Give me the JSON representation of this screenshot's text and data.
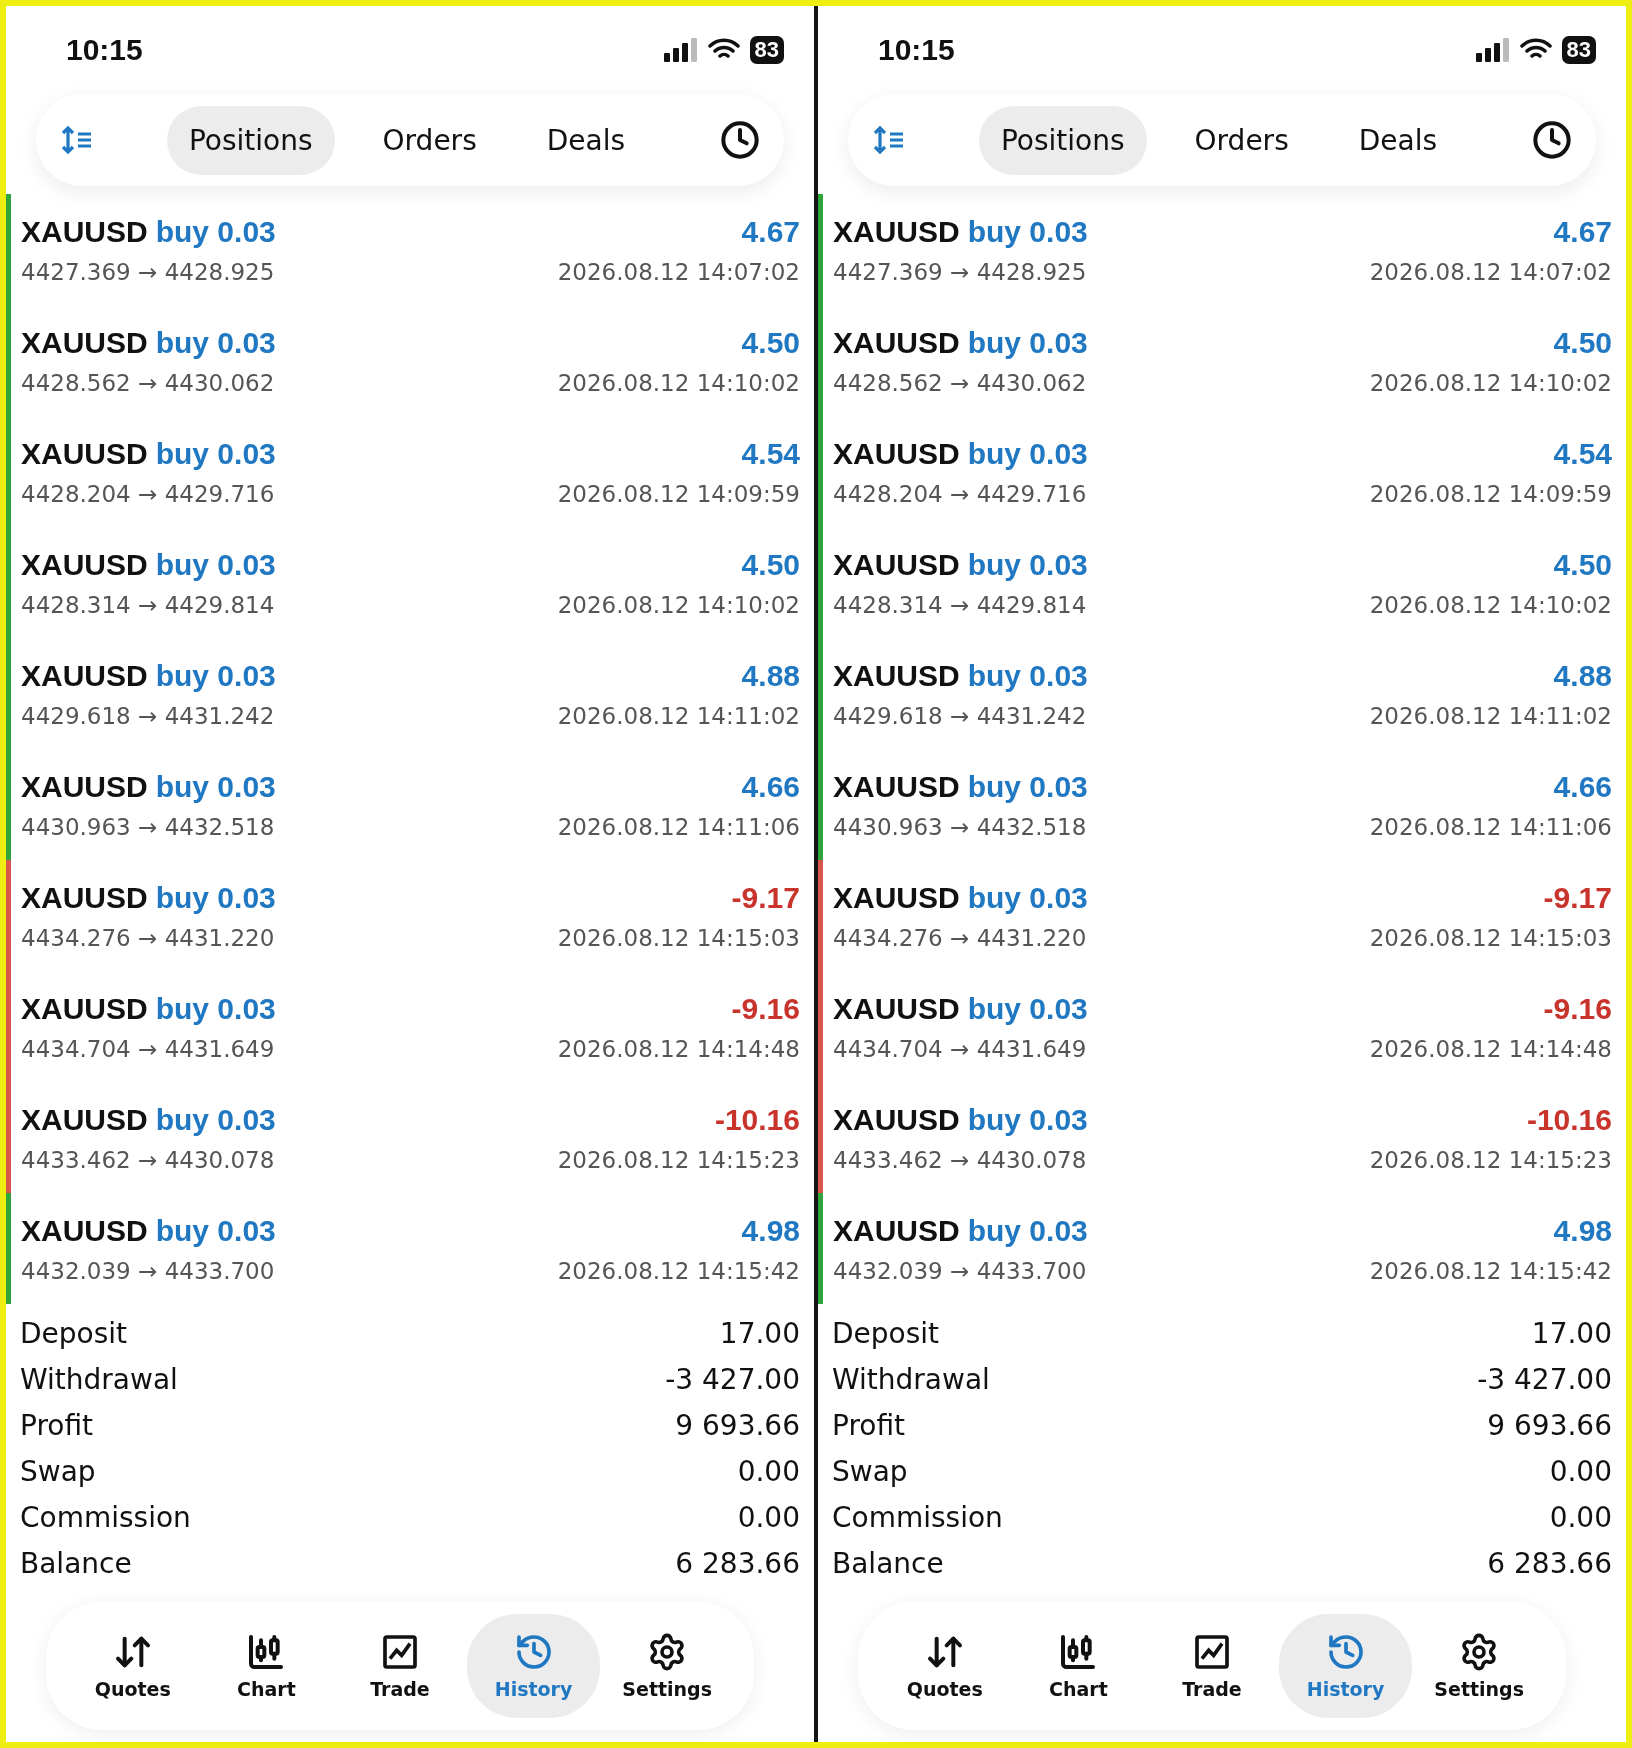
{
  "phones": [
    {
      "status_bar": {
        "time": "10:15",
        "battery": "83"
      },
      "tabs": [
        {
          "label": "Positions",
          "selected": true
        },
        {
          "label": "Orders",
          "selected": false
        },
        {
          "label": "Deals",
          "selected": false
        }
      ],
      "deals": [
        {
          "symbol": "XAUUSD",
          "side": "buy 0.03",
          "profit": "4.67",
          "kind": "gain",
          "prices": "4427.369 → 4428.925",
          "time": "2026.08.12 14:07:02"
        },
        {
          "symbol": "XAUUSD",
          "side": "buy 0.03",
          "profit": "4.50",
          "kind": "gain",
          "prices": "4428.562 → 4430.062",
          "time": "2026.08.12 14:10:02"
        },
        {
          "symbol": "XAUUSD",
          "side": "buy 0.03",
          "profit": "4.54",
          "kind": "gain",
          "prices": "4428.204 → 4429.716",
          "time": "2026.08.12 14:09:59"
        },
        {
          "symbol": "XAUUSD",
          "side": "buy 0.03",
          "profit": "4.50",
          "kind": "gain",
          "prices": "4428.314 → 4429.814",
          "time": "2026.08.12 14:10:02"
        },
        {
          "symbol": "XAUUSD",
          "side": "buy 0.03",
          "profit": "4.88",
          "kind": "gain",
          "prices": "4429.618 → 4431.242",
          "time": "2026.08.12 14:11:02"
        },
        {
          "symbol": "XAUUSD",
          "side": "buy 0.03",
          "profit": "4.66",
          "kind": "gain",
          "prices": "4430.963 → 4432.518",
          "time": "2026.08.12 14:11:06"
        },
        {
          "symbol": "XAUUSD",
          "side": "buy 0.03",
          "profit": "-9.17",
          "kind": "loss",
          "prices": "4434.276 → 4431.220",
          "time": "2026.08.12 14:15:03"
        },
        {
          "symbol": "XAUUSD",
          "side": "buy 0.03",
          "profit": "-9.16",
          "kind": "loss",
          "prices": "4434.704 → 4431.649",
          "time": "2026.08.12 14:14:48"
        },
        {
          "symbol": "XAUUSD",
          "side": "buy 0.03",
          "profit": "-10.16",
          "kind": "loss",
          "prices": "4433.462 → 4430.078",
          "time": "2026.08.12 14:15:23"
        },
        {
          "symbol": "XAUUSD",
          "side": "buy 0.03",
          "profit": "4.98",
          "kind": "gain",
          "prices": "4432.039 → 4433.700",
          "time": "2026.08.12 14:15:42"
        }
      ],
      "summary": [
        {
          "label": "Deposit",
          "value": "17.00"
        },
        {
          "label": "Withdrawal",
          "value": "-3 427.00"
        },
        {
          "label": "Profit",
          "value": "9 693.66"
        },
        {
          "label": "Swap",
          "value": "0.00"
        },
        {
          "label": "Commission",
          "value": "0.00"
        },
        {
          "label": "Balance",
          "value": "6 283.66"
        }
      ],
      "nav": [
        {
          "label": "Quotes",
          "kind": "quotes",
          "selected": false
        },
        {
          "label": "Chart",
          "kind": "chart",
          "selected": false
        },
        {
          "label": "Trade",
          "kind": "trade",
          "selected": false
        },
        {
          "label": "History",
          "kind": "history",
          "selected": true
        },
        {
          "label": "Settings",
          "kind": "settings",
          "selected": false
        }
      ]
    },
    {
      "status_bar": {
        "time": "10:15",
        "battery": "83"
      },
      "tabs": [
        {
          "label": "Positions",
          "selected": true
        },
        {
          "label": "Orders",
          "selected": false
        },
        {
          "label": "Deals",
          "selected": false
        }
      ],
      "deals": [
        {
          "symbol": "XAUUSD",
          "side": "buy 0.03",
          "profit": "4.67",
          "kind": "gain",
          "prices": "4427.369 → 4428.925",
          "time": "2026.08.12 14:07:02"
        },
        {
          "symbol": "XAUUSD",
          "side": "buy 0.03",
          "profit": "4.50",
          "kind": "gain",
          "prices": "4428.562 → 4430.062",
          "time": "2026.08.12 14:10:02"
        },
        {
          "symbol": "XAUUSD",
          "side": "buy 0.03",
          "profit": "4.54",
          "kind": "gain",
          "prices": "4428.204 → 4429.716",
          "time": "2026.08.12 14:09:59"
        },
        {
          "symbol": "XAUUSD",
          "side": "buy 0.03",
          "profit": "4.50",
          "kind": "gain",
          "prices": "4428.314 → 4429.814",
          "time": "2026.08.12 14:10:02"
        },
        {
          "symbol": "XAUUSD",
          "side": "buy 0.03",
          "profit": "4.88",
          "kind": "gain",
          "prices": "4429.618 → 4431.242",
          "time": "2026.08.12 14:11:02"
        },
        {
          "symbol": "XAUUSD",
          "side": "buy 0.03",
          "profit": "4.66",
          "kind": "gain",
          "prices": "4430.963 → 4432.518",
          "time": "2026.08.12 14:11:06"
        },
        {
          "symbol": "XAUUSD",
          "side": "buy 0.03",
          "profit": "-9.17",
          "kind": "loss",
          "prices": "4434.276 → 4431.220",
          "time": "2026.08.12 14:15:03"
        },
        {
          "symbol": "XAUUSD",
          "side": "buy 0.03",
          "profit": "-9.16",
          "kind": "loss",
          "prices": "4434.704 → 4431.649",
          "time": "2026.08.12 14:14:48"
        },
        {
          "symbol": "XAUUSD",
          "side": "buy 0.03",
          "profit": "-10.16",
          "kind": "loss",
          "prices": "4433.462 → 4430.078",
          "time": "2026.08.12 14:15:23"
        },
        {
          "symbol": "XAUUSD",
          "side": "buy 0.03",
          "profit": "4.98",
          "kind": "gain",
          "prices": "4432.039 → 4433.700",
          "time": "2026.08.12 14:15:42"
        }
      ],
      "summary": [
        {
          "label": "Deposit",
          "value": "17.00"
        },
        {
          "label": "Withdrawal",
          "value": "-3 427.00"
        },
        {
          "label": "Profit",
          "value": "9 693.66"
        },
        {
          "label": "Swap",
          "value": "0.00"
        },
        {
          "label": "Commission",
          "value": "0.00"
        },
        {
          "label": "Balance",
          "value": "6 283.66"
        }
      ],
      "nav": [
        {
          "label": "Quotes",
          "kind": "quotes",
          "selected": false
        },
        {
          "label": "Chart",
          "kind": "chart",
          "selected": false
        },
        {
          "label": "Trade",
          "kind": "trade",
          "selected": false
        },
        {
          "label": "History",
          "kind": "history",
          "selected": true
        },
        {
          "label": "Settings",
          "kind": "settings",
          "selected": false
        }
      ]
    }
  ]
}
